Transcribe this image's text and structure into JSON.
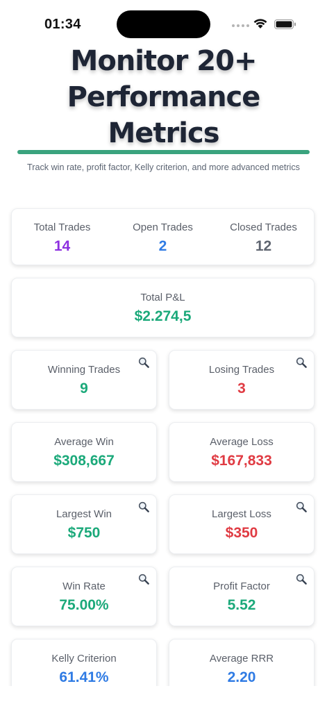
{
  "status_bar": {
    "time": "01:34"
  },
  "header": {
    "title_line1": "Monitor 20+",
    "title_line2": "Performance",
    "title_line3": "Metrics",
    "subtitle": "Track win rate, profit factor, Kelly criterion, and more advanced metrics",
    "accent": "#3aa37e"
  },
  "summary": {
    "total_trades_label": "Total Trades",
    "total_trades_value": "14",
    "open_trades_label": "Open Trades",
    "open_trades_value": "2",
    "closed_trades_label": "Closed Trades",
    "closed_trades_value": "12"
  },
  "pnl": {
    "label": "Total P&L",
    "value": "$2.274,5"
  },
  "metrics": {
    "winning_trades": {
      "label": "Winning Trades",
      "value": "9"
    },
    "losing_trades": {
      "label": "Losing Trades",
      "value": "3"
    },
    "average_win": {
      "label": "Average Win",
      "value": "$308,667"
    },
    "average_loss": {
      "label": "Average Loss",
      "value": "$167,833"
    },
    "largest_win": {
      "label": "Largest Win",
      "value": "$750"
    },
    "largest_loss": {
      "label": "Largest Loss",
      "value": "$350"
    },
    "win_rate": {
      "label": "Win Rate",
      "value": "75.00%"
    },
    "profit_factor": {
      "label": "Profit Factor",
      "value": "5.52"
    },
    "kelly": {
      "label": "Kelly Criterion",
      "value": "61.41%"
    },
    "avg_rrr": {
      "label": "Average RRR",
      "value": "2.20"
    }
  },
  "colors": {
    "positive": "#1ba97a",
    "negative": "#e03b43",
    "info": "#2f7be4",
    "highlight": "#8d2fe0"
  },
  "icons": {
    "magnifier": "magnifying-glass-icon"
  }
}
